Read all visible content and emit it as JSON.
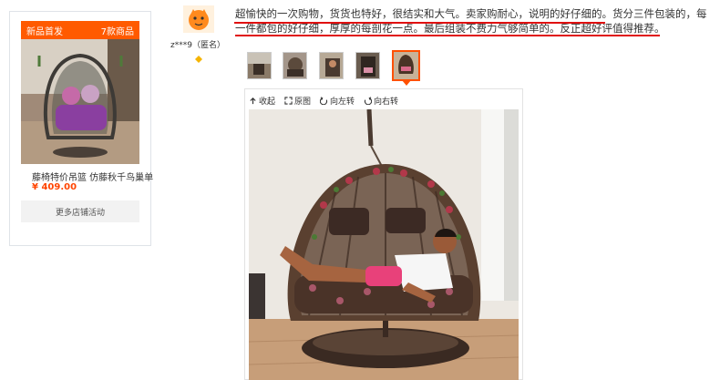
{
  "promo": {
    "badge_left": "新品首发",
    "badge_right": "7款商品",
    "title": "藤椅特价吊篮  仿藤秋千鸟巢单",
    "price": "¥ 409.00",
    "more_button": "更多店铺活动"
  },
  "review": {
    "reviewer": "z***9（匿名）",
    "lines": [
      "超愉快的一次购物，货货也特好，很结实和大气。卖家购耐心，说明的好仔细的。货分三件包装的，每",
      "一件都包的好仔细，厚厚的每剖花一点。最后组装不费力气够简单的。反正超好评值得推荐。"
    ]
  },
  "thumbnails": [
    "photo-1",
    "photo-2",
    "photo-3",
    "photo-4",
    "photo-5"
  ],
  "toolbar": {
    "collapse": "收起",
    "original": "原图",
    "rotate_left": "向左转",
    "rotate_right": "向右转"
  },
  "colors": {
    "accent": "#ff5000",
    "price": "#ff4400",
    "underline": "#e01010"
  }
}
